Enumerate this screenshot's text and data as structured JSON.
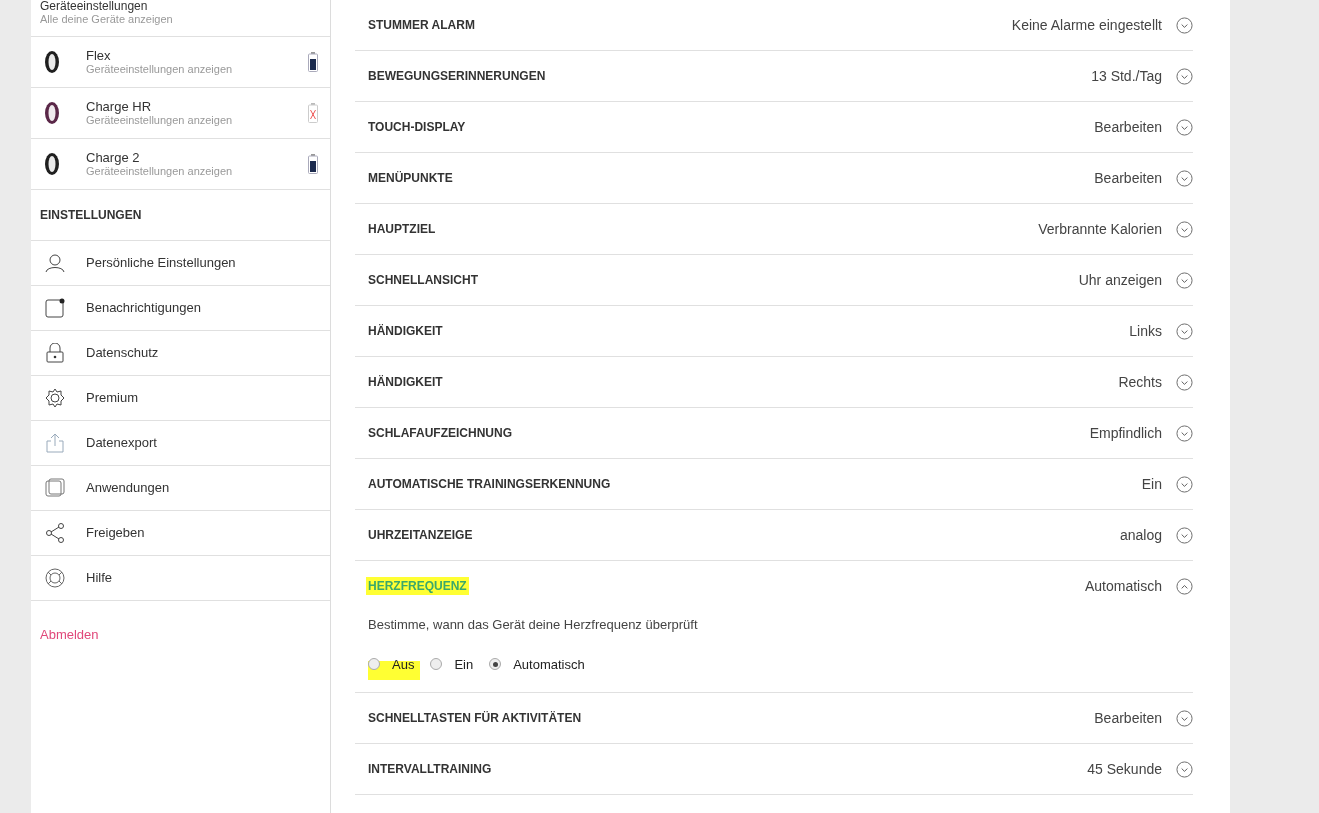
{
  "sidebar": {
    "devices_header": {
      "title": "Geräteeinstellungen",
      "subtitle": "Alle deine Geräte anzeigen"
    },
    "devices": [
      {
        "name": "Flex",
        "link": "Geräteeinstellungen anzeigen",
        "color": "#1f1f1f",
        "battery_error": false
      },
      {
        "name": "Charge HR",
        "link": "Geräteeinstellungen anzeigen",
        "color": "#5a2748",
        "battery_error": true
      },
      {
        "name": "Charge 2",
        "link": "Geräteeinstellungen anzeigen",
        "color": "#1f1f1f",
        "battery_error": false
      }
    ],
    "settings_title": "EINSTELLUNGEN",
    "items": [
      {
        "kind": "person",
        "label": "Persönliche Einstellungen"
      },
      {
        "kind": "notification",
        "label": "Benachrichtigungen"
      },
      {
        "kind": "lock",
        "label": "Datenschutz"
      },
      {
        "kind": "gear",
        "label": "Premium"
      },
      {
        "kind": "export",
        "label": "Datenexport"
      },
      {
        "kind": "apps",
        "label": "Anwendungen"
      },
      {
        "kind": "share",
        "label": "Freigeben"
      },
      {
        "kind": "help",
        "label": "Hilfe"
      }
    ],
    "logout": "Abmelden"
  },
  "settings": [
    {
      "title": "STUMMER ALARM",
      "value": "Keine Alarme eingestellt",
      "expanded": false
    },
    {
      "title": "BEWEGUNGSERINNERUNGEN",
      "value": "13 Std./Tag",
      "expanded": false
    },
    {
      "title": "TOUCH-DISPLAY",
      "value": "Bearbeiten",
      "expanded": false
    },
    {
      "title": "MENÜPUNKTE",
      "value": "Bearbeiten",
      "expanded": false
    },
    {
      "title": "HAUPTZIEL",
      "value": "Verbrannte Kalorien",
      "expanded": false
    },
    {
      "title": "SCHNELLANSICHT",
      "value": "Uhr anzeigen",
      "expanded": false
    },
    {
      "title": "HÄNDIGKEIT",
      "value": "Links",
      "expanded": false
    },
    {
      "title": "HÄNDIGKEIT",
      "value": "Rechts",
      "expanded": false
    },
    {
      "title": "SCHLAFAUFZEICHNUNG",
      "value": "Empfindlich",
      "expanded": false
    },
    {
      "title": "AUTOMATISCHE TRAININGSERKENNUNG",
      "value": "Ein",
      "expanded": false
    },
    {
      "title": "UHRZEITANZEIGE",
      "value": "analog",
      "expanded": false
    },
    {
      "title": "HERZFREQUENZ",
      "value": "Automatisch",
      "expanded": true,
      "highlighted": true,
      "description": "Bestimme, wann das Gerät deine Herzfrequenz überprüft",
      "options": [
        {
          "label": "Aus",
          "selected": false,
          "highlighted": true
        },
        {
          "label": "Ein",
          "selected": false,
          "highlighted": false
        },
        {
          "label": "Automatisch",
          "selected": true,
          "highlighted": false
        }
      ]
    },
    {
      "title": "SCHNELLTASTEN FÜR AKTIVITÄTEN",
      "value": "Bearbeiten",
      "expanded": false
    },
    {
      "title": "INTERVALLTRAINING",
      "value": "45 Sekunde",
      "expanded": false
    }
  ]
}
